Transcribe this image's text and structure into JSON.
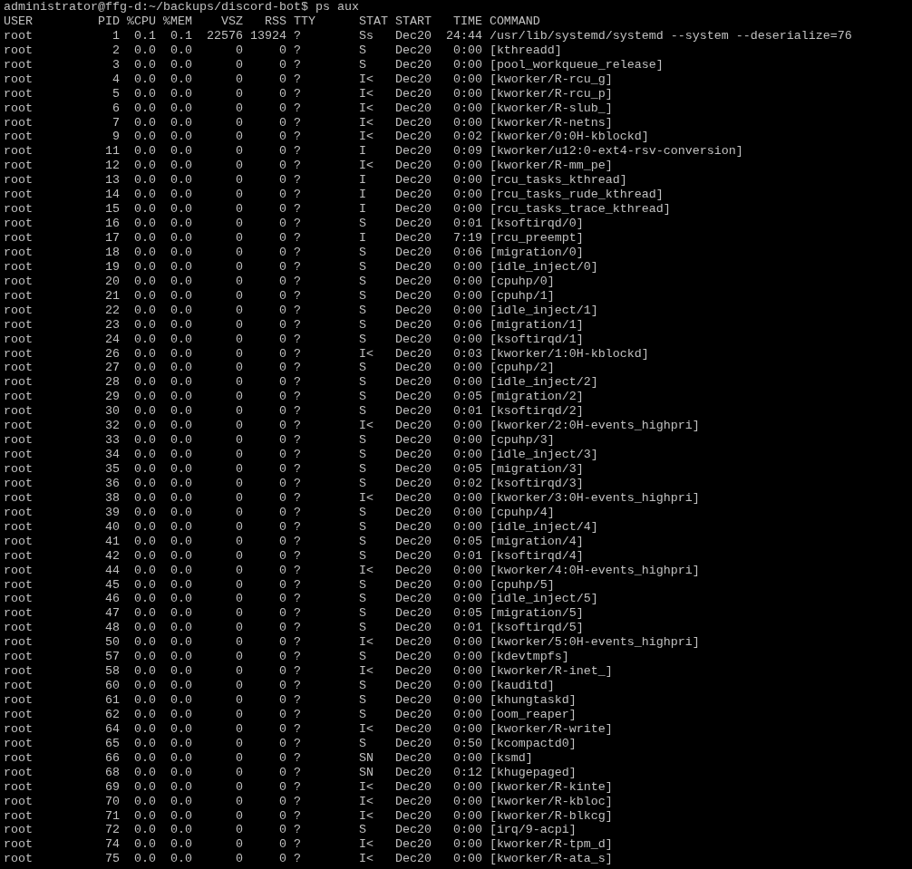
{
  "terminal": {
    "prompt_line": "administrator@ffg-d:~/backups/discord-bot$ ps aux",
    "header": "USER         PID %CPU %MEM    VSZ   RSS TTY      STAT START   TIME COMMAND",
    "lines": [
      "root           1  0.1  0.1  22576 13924 ?        Ss   Dec20  24:44 /usr/lib/systemd/systemd --system --deserialize=76",
      "root           2  0.0  0.0      0     0 ?        S    Dec20   0:00 [kthreadd]",
      "root           3  0.0  0.0      0     0 ?        S    Dec20   0:00 [pool_workqueue_release]",
      "root           4  0.0  0.0      0     0 ?        I<   Dec20   0:00 [kworker/R-rcu_g]",
      "root           5  0.0  0.0      0     0 ?        I<   Dec20   0:00 [kworker/R-rcu_p]",
      "root           6  0.0  0.0      0     0 ?        I<   Dec20   0:00 [kworker/R-slub_]",
      "root           7  0.0  0.0      0     0 ?        I<   Dec20   0:00 [kworker/R-netns]",
      "root           9  0.0  0.0      0     0 ?        I<   Dec20   0:02 [kworker/0:0H-kblockd]",
      "root          11  0.0  0.0      0     0 ?        I    Dec20   0:09 [kworker/u12:0-ext4-rsv-conversion]",
      "root          12  0.0  0.0      0     0 ?        I<   Dec20   0:00 [kworker/R-mm_pe]",
      "root          13  0.0  0.0      0     0 ?        I    Dec20   0:00 [rcu_tasks_kthread]",
      "root          14  0.0  0.0      0     0 ?        I    Dec20   0:00 [rcu_tasks_rude_kthread]",
      "root          15  0.0  0.0      0     0 ?        I    Dec20   0:00 [rcu_tasks_trace_kthread]",
      "root          16  0.0  0.0      0     0 ?        S    Dec20   0:01 [ksoftirqd/0]",
      "root          17  0.0  0.0      0     0 ?        I    Dec20   7:19 [rcu_preempt]",
      "root          18  0.0  0.0      0     0 ?        S    Dec20   0:06 [migration/0]",
      "root          19  0.0  0.0      0     0 ?        S    Dec20   0:00 [idle_inject/0]",
      "root          20  0.0  0.0      0     0 ?        S    Dec20   0:00 [cpuhp/0]",
      "root          21  0.0  0.0      0     0 ?        S    Dec20   0:00 [cpuhp/1]",
      "root          22  0.0  0.0      0     0 ?        S    Dec20   0:00 [idle_inject/1]",
      "root          23  0.0  0.0      0     0 ?        S    Dec20   0:06 [migration/1]",
      "root          24  0.0  0.0      0     0 ?        S    Dec20   0:00 [ksoftirqd/1]",
      "root          26  0.0  0.0      0     0 ?        I<   Dec20   0:03 [kworker/1:0H-kblockd]",
      "root          27  0.0  0.0      0     0 ?        S    Dec20   0:00 [cpuhp/2]",
      "root          28  0.0  0.0      0     0 ?        S    Dec20   0:00 [idle_inject/2]",
      "root          29  0.0  0.0      0     0 ?        S    Dec20   0:05 [migration/2]",
      "root          30  0.0  0.0      0     0 ?        S    Dec20   0:01 [ksoftirqd/2]",
      "root          32  0.0  0.0      0     0 ?        I<   Dec20   0:00 [kworker/2:0H-events_highpri]",
      "root          33  0.0  0.0      0     0 ?        S    Dec20   0:00 [cpuhp/3]",
      "root          34  0.0  0.0      0     0 ?        S    Dec20   0:00 [idle_inject/3]",
      "root          35  0.0  0.0      0     0 ?        S    Dec20   0:05 [migration/3]",
      "root          36  0.0  0.0      0     0 ?        S    Dec20   0:02 [ksoftirqd/3]",
      "root          38  0.0  0.0      0     0 ?        I<   Dec20   0:00 [kworker/3:0H-events_highpri]",
      "root          39  0.0  0.0      0     0 ?        S    Dec20   0:00 [cpuhp/4]",
      "root          40  0.0  0.0      0     0 ?        S    Dec20   0:00 [idle_inject/4]",
      "root          41  0.0  0.0      0     0 ?        S    Dec20   0:05 [migration/4]",
      "root          42  0.0  0.0      0     0 ?        S    Dec20   0:01 [ksoftirqd/4]",
      "root          44  0.0  0.0      0     0 ?        I<   Dec20   0:00 [kworker/4:0H-events_highpri]",
      "root          45  0.0  0.0      0     0 ?        S    Dec20   0:00 [cpuhp/5]",
      "root          46  0.0  0.0      0     0 ?        S    Dec20   0:00 [idle_inject/5]",
      "root          47  0.0  0.0      0     0 ?        S    Dec20   0:05 [migration/5]",
      "root          48  0.0  0.0      0     0 ?        S    Dec20   0:01 [ksoftirqd/5]",
      "root          50  0.0  0.0      0     0 ?        I<   Dec20   0:00 [kworker/5:0H-events_highpri]",
      "root          57  0.0  0.0      0     0 ?        S    Dec20   0:00 [kdevtmpfs]",
      "root          58  0.0  0.0      0     0 ?        I<   Dec20   0:00 [kworker/R-inet_]",
      "root          60  0.0  0.0      0     0 ?        S    Dec20   0:00 [kauditd]",
      "root          61  0.0  0.0      0     0 ?        S    Dec20   0:00 [khungtaskd]",
      "root          62  0.0  0.0      0     0 ?        S    Dec20   0:00 [oom_reaper]",
      "root          64  0.0  0.0      0     0 ?        I<   Dec20   0:00 [kworker/R-write]",
      "root          65  0.0  0.0      0     0 ?        S    Dec20   0:50 [kcompactd0]",
      "root          66  0.0  0.0      0     0 ?        SN   Dec20   0:00 [ksmd]",
      "root          68  0.0  0.0      0     0 ?        SN   Dec20   0:12 [khugepaged]",
      "root          69  0.0  0.0      0     0 ?        I<   Dec20   0:00 [kworker/R-kinte]",
      "root          70  0.0  0.0      0     0 ?        I<   Dec20   0:00 [kworker/R-kbloc]",
      "root          71  0.0  0.0      0     0 ?        I<   Dec20   0:00 [kworker/R-blkcg]",
      "root          72  0.0  0.0      0     0 ?        S    Dec20   0:00 [irq/9-acpi]",
      "root          74  0.0  0.0      0     0 ?        I<   Dec20   0:00 [kworker/R-tpm_d]",
      "root          75  0.0  0.0      0     0 ?        I<   Dec20   0:00 [kworker/R-ata_s]"
    ]
  }
}
